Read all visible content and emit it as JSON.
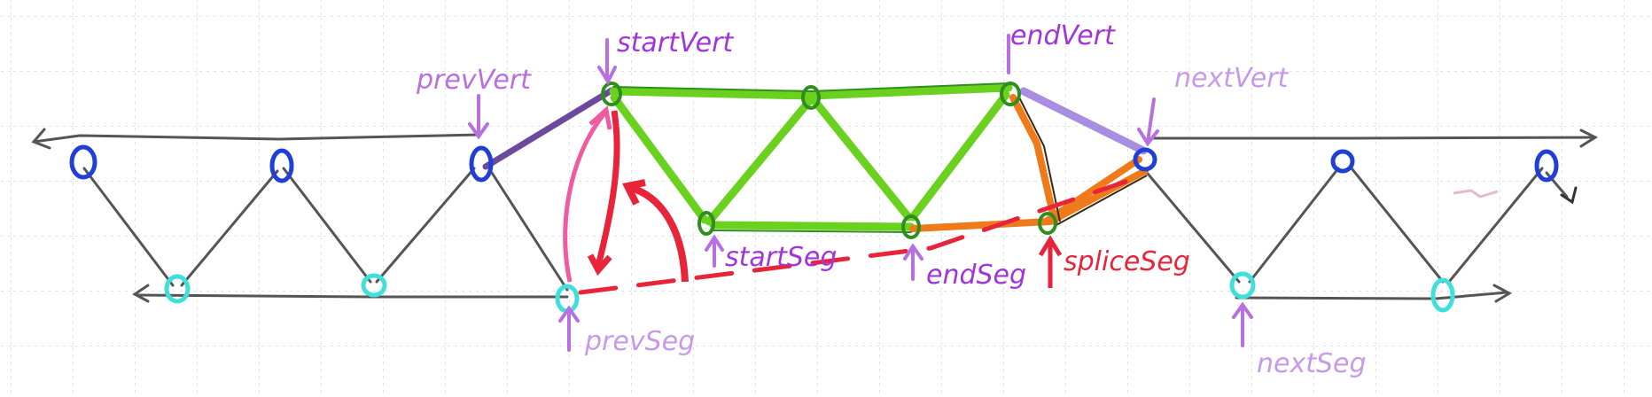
{
  "labels": {
    "prev_vert": "prevVert",
    "start_vert": "startVert",
    "end_vert": "endVert",
    "next_vert": "nextVert",
    "start_seg": "startSeg",
    "end_seg": "endSeg",
    "splice_seg": "spliceSeg",
    "prev_seg": "prevSeg",
    "next_seg": "nextSeg"
  },
  "colors": {
    "paper_grid": "#d9d9d9",
    "strand": "#555555",
    "top_vertex": "#1f3fd6",
    "bottom_vertex": "#3fe0dc",
    "splice_region": "#6ad11f",
    "splice_vertex": "#2e8f1e",
    "link_to_neighbor": "#6b4a9e",
    "splice_path": "#ef7a1a",
    "pointer_red": "#e8243a",
    "pointer_pink": "#f05aa0",
    "label_purple": "#a235d9"
  },
  "icons": {
    "strand_arrow": "arrow-icon",
    "vertex": "circle-icon"
  }
}
